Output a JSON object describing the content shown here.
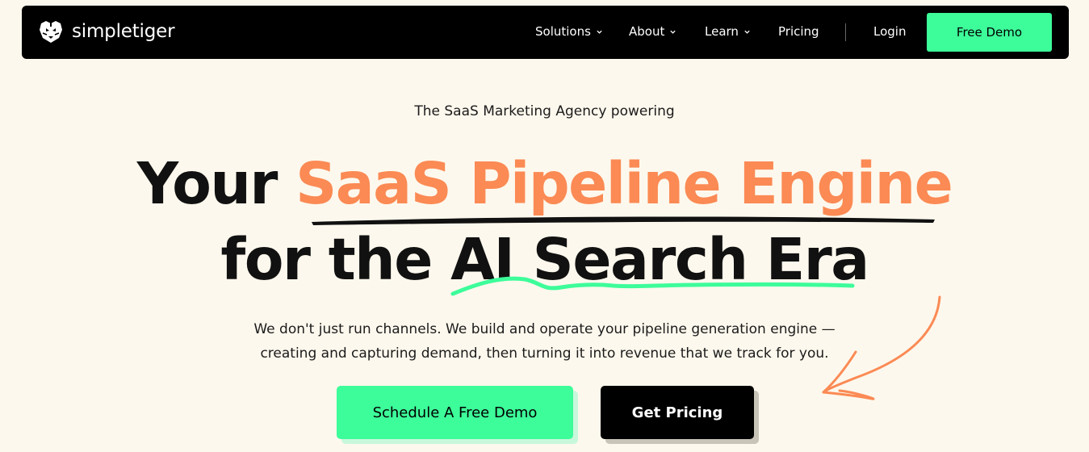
{
  "brand": {
    "name": "simpletiger",
    "logo_icon": "tiger-head-icon"
  },
  "nav": {
    "items": [
      {
        "label": "Solutions",
        "has_dropdown": true
      },
      {
        "label": "About",
        "has_dropdown": true
      },
      {
        "label": "Learn",
        "has_dropdown": true
      },
      {
        "label": "Pricing",
        "has_dropdown": false
      }
    ],
    "login_label": "Login",
    "cta_label": "Free Demo"
  },
  "hero": {
    "tagline": "The SaaS Marketing Agency powering",
    "headline_line1_plain": "Your ",
    "headline_line1_accent": "SaaS Pipeline Engine",
    "headline_line2_plain": "for the ",
    "headline_line2_underlined": "AI Search Era",
    "description_line1": "We don't just run channels. We build and operate your pipeline generation engine —",
    "description_line2": "creating and capturing demand, then turning it into revenue that we track for you.",
    "primary_cta": "Schedule A Free Demo",
    "secondary_cta": "Get Pricing"
  },
  "colors": {
    "background": "#fdf8ed",
    "accent_orange": "#fb8a54",
    "accent_green": "#3dfc9a",
    "nav_background": "#000000"
  }
}
